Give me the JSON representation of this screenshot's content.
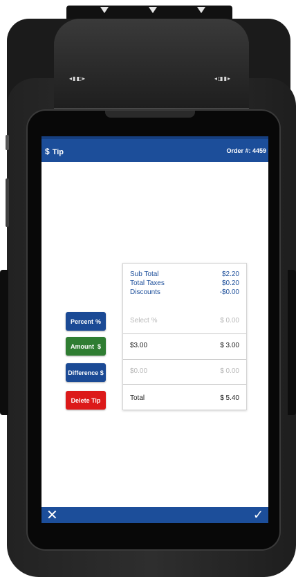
{
  "header": {
    "title_icon": "$",
    "title": "Tip",
    "order_label": "Order #: 4459"
  },
  "buttons": {
    "percent": {
      "label": "Percent",
      "symbol": "%"
    },
    "amount": {
      "label": "Amount",
      "symbol": "$"
    },
    "difference": {
      "label": "Difference $"
    },
    "delete": {
      "label": "Delete Tip"
    }
  },
  "summary": {
    "subtotal": {
      "label": "Sub Total",
      "value": "$2.20"
    },
    "taxes": {
      "label": "Total Taxes",
      "value": "$0.20"
    },
    "discounts": {
      "label": "Discounts",
      "value": "-$0.00"
    }
  },
  "tip_rows": {
    "percent": {
      "placeholder": "Select %",
      "value": "$ 0.00"
    },
    "amount": {
      "value": "$3.00",
      "total": "$ 3.00"
    },
    "difference": {
      "value": "$0.00",
      "total": "$ 0.00"
    }
  },
  "total": {
    "label": "Total",
    "value": "$ 5.40"
  },
  "footer": {
    "close_glyph": "✕",
    "confirm_glyph": "✓"
  },
  "colors": {
    "header_blue": "#1c4e9a",
    "amount_green": "#2f7d32",
    "delete_red": "#dc1a1a"
  }
}
